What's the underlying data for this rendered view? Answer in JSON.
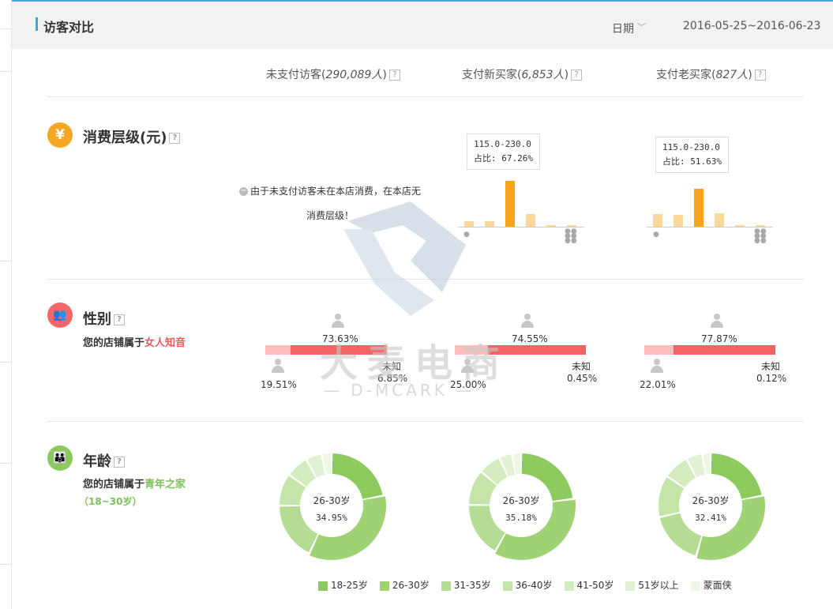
{
  "header": {
    "title": "访客对比",
    "date_label": "日期",
    "date_range": "2016-05-25~2016-06-23"
  },
  "columns": [
    {
      "label": "未支付访客",
      "count": "290,089人"
    },
    {
      "label": "支付新买家",
      "count": "6,853人"
    },
    {
      "label": "支付老买家",
      "count": "827人"
    }
  ],
  "help_glyph": "?",
  "consumption": {
    "title": "消费层级(元)",
    "icon": "yen-icon",
    "icon_glyph": "¥",
    "icon_color": "#f5a623",
    "note_line1": "由于未支付访客未在本店消费，在本店无",
    "note_line2": "消费层级！",
    "charts": [
      {
        "tooltip_range": "115.0-230.0",
        "tooltip_ratio": "占比: 67.26%",
        "values": [
          8,
          8,
          64,
          18,
          2,
          2
        ],
        "highlight": 2
      },
      {
        "tooltip_range": "115.0-230.0",
        "tooltip_ratio": "占比: 51.63%",
        "values": [
          18,
          17,
          53,
          19,
          2,
          2
        ],
        "highlight": 2
      }
    ]
  },
  "gender": {
    "title": "性别",
    "icon": "people-icon",
    "icon_color": "#f16868",
    "summary_prefix": "您的店铺属于",
    "summary_value": "女人知音",
    "unknown_label": "未知",
    "groups": [
      {
        "female": "73.63%",
        "male": "19.51%",
        "unknown": "6.85%",
        "female_frac": 0.7363,
        "male_frac": 0.1951
      },
      {
        "female": "74.55%",
        "male": "25.00%",
        "unknown": "0.45%",
        "female_frac": 0.7455,
        "male_frac": 0.25
      },
      {
        "female": "77.87%",
        "male": "22.01%",
        "unknown": "0.12%",
        "female_frac": 0.7787,
        "male_frac": 0.2201
      }
    ]
  },
  "age": {
    "title": "年龄",
    "icon": "family-icon",
    "icon_color": "#8dca5e",
    "summary_prefix": "您的店铺属于",
    "summary_value": "青年之家",
    "summary_range": "（18~30岁）",
    "donuts": [
      {
        "center_label": "26-30岁",
        "center_pct": "34.95%",
        "slices": [
          22.0,
          34.95,
          18.0,
          10.0,
          7.0,
          5.0,
          3.05
        ]
      },
      {
        "center_label": "26-30岁",
        "center_pct": "35.18%",
        "slices": [
          23.0,
          35.18,
          17.0,
          11.0,
          7.0,
          4.0,
          2.82
        ]
      },
      {
        "center_label": "26-30岁",
        "center_pct": "32.41%",
        "slices": [
          22.0,
          32.41,
          17.0,
          13.0,
          8.0,
          5.0,
          2.59
        ]
      }
    ],
    "legend": [
      {
        "label": "18-25岁",
        "color": "#8dca5e"
      },
      {
        "label": "26-30岁",
        "color": "#9fd272"
      },
      {
        "label": "31-35岁",
        "color": "#b4dc92"
      },
      {
        "label": "36-40岁",
        "color": "#c5e4a9"
      },
      {
        "label": "41-50岁",
        "color": "#d4ebbf"
      },
      {
        "label": "51岁以上",
        "color": "#e2f1d3"
      },
      {
        "label": "蒙面侠",
        "color": "#eef6e6"
      }
    ]
  },
  "colors": {
    "bar_highlight": "#f7a419",
    "bar_normal": "#fdd79a",
    "female_bar": "#f36363",
    "male_bar": "#ffbcbc"
  },
  "watermark": {
    "text": "大麦电商",
    "sub": "— D-MCARK —"
  }
}
